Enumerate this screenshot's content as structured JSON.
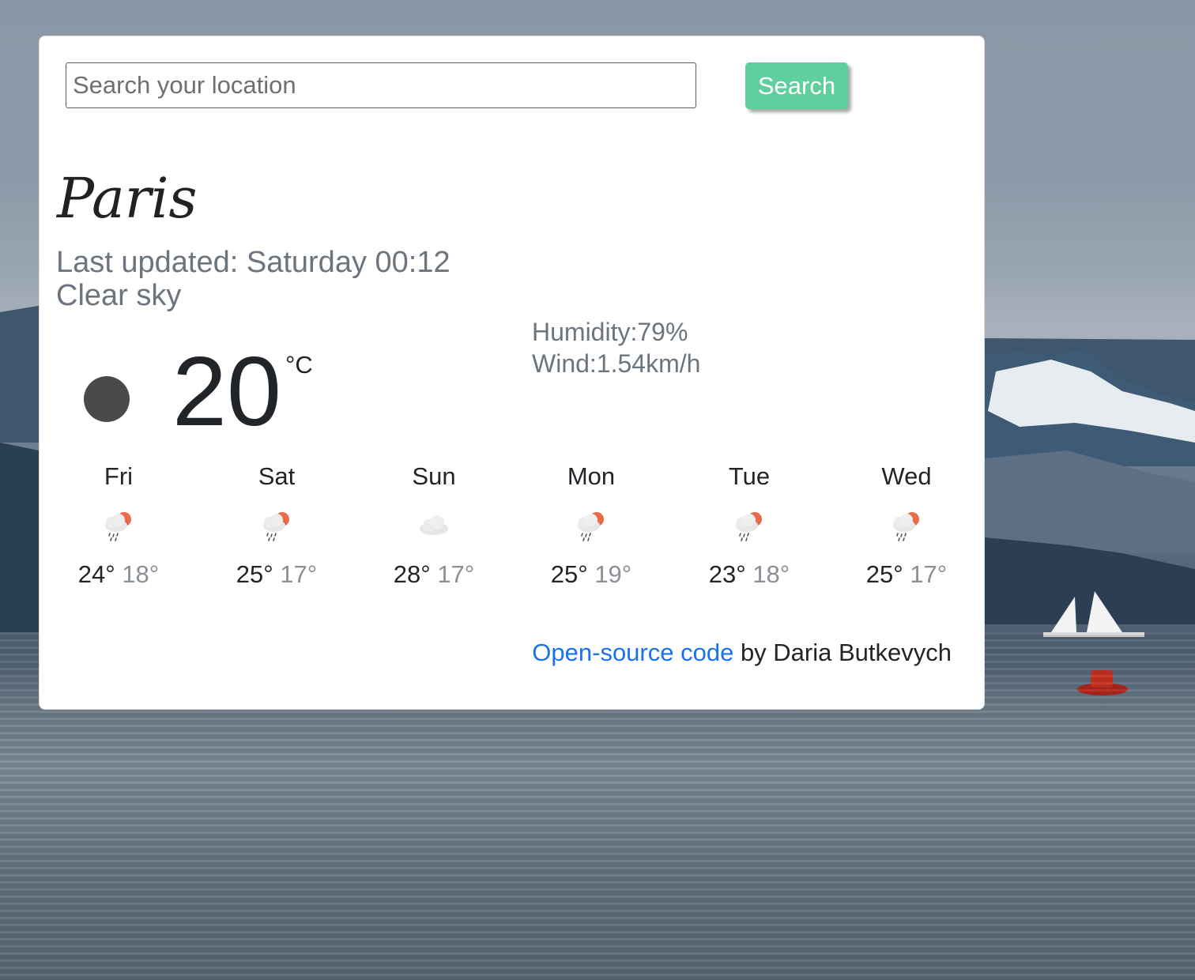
{
  "search": {
    "placeholder": "Search your location",
    "button_label": "Search"
  },
  "current": {
    "city": "Paris",
    "last_updated": "Last updated: Saturday 00:12",
    "description": "Clear sky",
    "temperature": "20",
    "unit": "°C",
    "humidity": "Humidity:79%",
    "wind": "Wind:1.54km/h",
    "icon": "moon-icon"
  },
  "forecast": [
    {
      "day": "Fri",
      "max": "24°",
      "min": "18°",
      "icon": "rain-sun-icon"
    },
    {
      "day": "Sat",
      "max": "25°",
      "min": "17°",
      "icon": "rain-sun-icon"
    },
    {
      "day": "Sun",
      "max": "28°",
      "min": "17°",
      "icon": "cloud-icon"
    },
    {
      "day": "Mon",
      "max": "25°",
      "min": "19°",
      "icon": "rain-sun-icon"
    },
    {
      "day": "Tue",
      "max": "23°",
      "min": "18°",
      "icon": "rain-sun-icon"
    },
    {
      "day": "Wed",
      "max": "25°",
      "min": "17°",
      "icon": "rain-sun-icon"
    }
  ],
  "footer": {
    "link_text": "Open-source code",
    "author_text": " by Daria Butkevych"
  },
  "colors": {
    "accent": "#5fcf9e",
    "link": "#1a73e8",
    "muted_text": "#6c757d"
  }
}
